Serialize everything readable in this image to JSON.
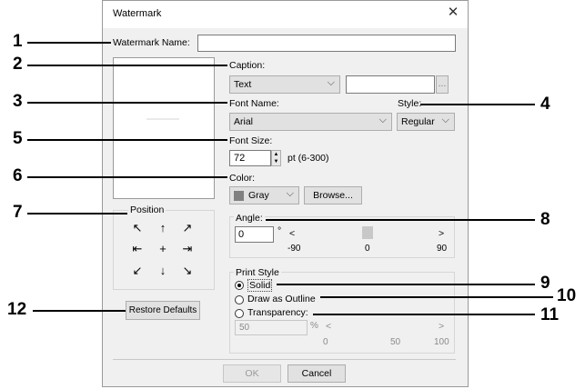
{
  "dialog": {
    "title": "Watermark",
    "close_glyph": "✕",
    "watermark_name_label": "Watermark Name:",
    "watermark_name_value": "",
    "caption_label": "Caption:",
    "caption_type": "Text",
    "caption_text": "",
    "ellipsis": "...",
    "font_name_label": "Font Name:",
    "font_name_value": "Arial",
    "style_label": "Style:",
    "style_value": "Regular",
    "font_size_label": "Font Size:",
    "font_size_value": "72",
    "font_size_range": "pt (6-300)",
    "color_label": "Color:",
    "color_value": "Gray",
    "color_swatch": "#808080",
    "browse_label": "Browse...",
    "position_label": "Position",
    "position_arrows": [
      "↖",
      "↑",
      "↗",
      "⇤",
      "+",
      "⇥",
      "↙",
      "↓",
      "↘"
    ],
    "angle_label": "Angle:",
    "angle_value": "0",
    "angle_unit": "°",
    "angle_slider": {
      "min": "-90",
      "mid": "0",
      "max": "90",
      "left_arrow": "<",
      "right_arrow": ">",
      "value": 0
    },
    "print_style_label": "Print Style",
    "solid_label": "Solid",
    "outline_label": "Draw as Outline",
    "transparency_label": "Transparency:",
    "transparency_value": "50",
    "transparency_unit": "%",
    "transparency_slider": {
      "left_arrow": "<",
      "right_arrow": ">",
      "min": "0",
      "mid": "50",
      "max": "100"
    },
    "selected_print_style": "Solid",
    "restore_label": "Restore Defaults",
    "ok_label": "OK",
    "cancel_label": "Cancel"
  },
  "callouts": [
    "1",
    "2",
    "3",
    "4",
    "5",
    "6",
    "7",
    "8",
    "9",
    "10",
    "11",
    "12"
  ]
}
